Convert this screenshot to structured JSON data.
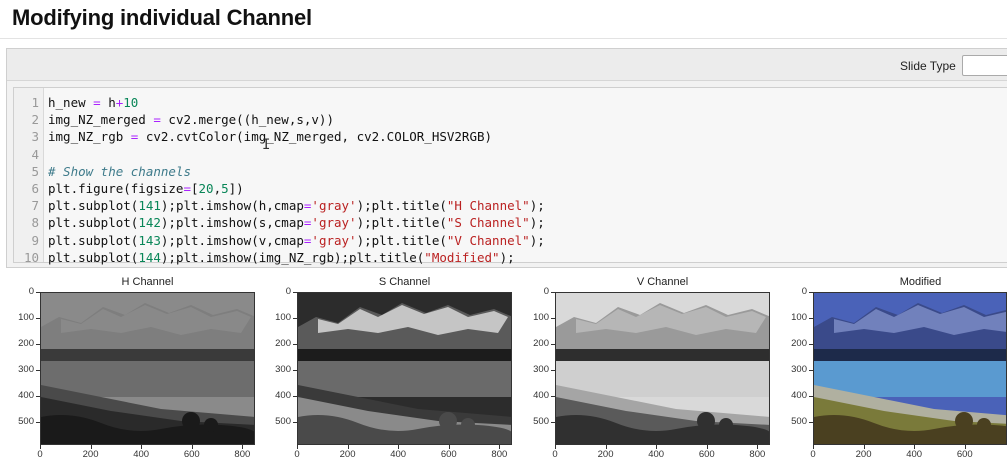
{
  "heading": {
    "title": "Modifying individual Channel"
  },
  "toolbar": {
    "slide_type_label": "Slide Type"
  },
  "code_lines": [
    {
      "num": "1",
      "text": "h_new = h+10"
    },
    {
      "num": "2",
      "text": "img_NZ_merged = cv2.merge((h_new,s,v))"
    },
    {
      "num": "3",
      "text": "img_NZ_rgb = cv2.cvtColor(img_NZ_merged, cv2.COLOR_HSV2RGB)"
    },
    {
      "num": "4",
      "text": ""
    },
    {
      "num": "5",
      "text": "# Show the channels"
    },
    {
      "num": "6",
      "text": "plt.figure(figsize=[20,5])"
    },
    {
      "num": "7",
      "text": "plt.subplot(141);plt.imshow(h,cmap='gray');plt.title(\"H Channel\");"
    },
    {
      "num": "8",
      "text": "plt.subplot(142);plt.imshow(s,cmap='gray');plt.title(\"S Channel\");"
    },
    {
      "num": "9",
      "text": "plt.subplot(143);plt.imshow(v,cmap='gray');plt.title(\"V Channel\");"
    },
    {
      "num": "10",
      "text": "plt.subplot(144);plt.imshow(img_NZ_rgb);plt.title(\"Modified\");"
    }
  ],
  "figure": {
    "panels": [
      {
        "title": "H Channel",
        "style": "hue"
      },
      {
        "title": "S Channel",
        "style": "sat"
      },
      {
        "title": "V Channel",
        "style": "val"
      },
      {
        "title": "Modified",
        "style": "rgb"
      }
    ],
    "yticks": [
      "0",
      "100",
      "200",
      "300",
      "400",
      "500"
    ],
    "xticks": [
      "0",
      "200",
      "400",
      "600",
      "800"
    ],
    "ytick_values": [
      0,
      100,
      200,
      300,
      400,
      500
    ],
    "xtick_values": [
      0,
      200,
      400,
      600,
      800
    ],
    "image_height": 590,
    "image_width": 850
  },
  "colors": {
    "comment": "#3d7a8a",
    "keyword_op": "#aa22ff",
    "number": "#098658",
    "string": "#ba2121"
  }
}
